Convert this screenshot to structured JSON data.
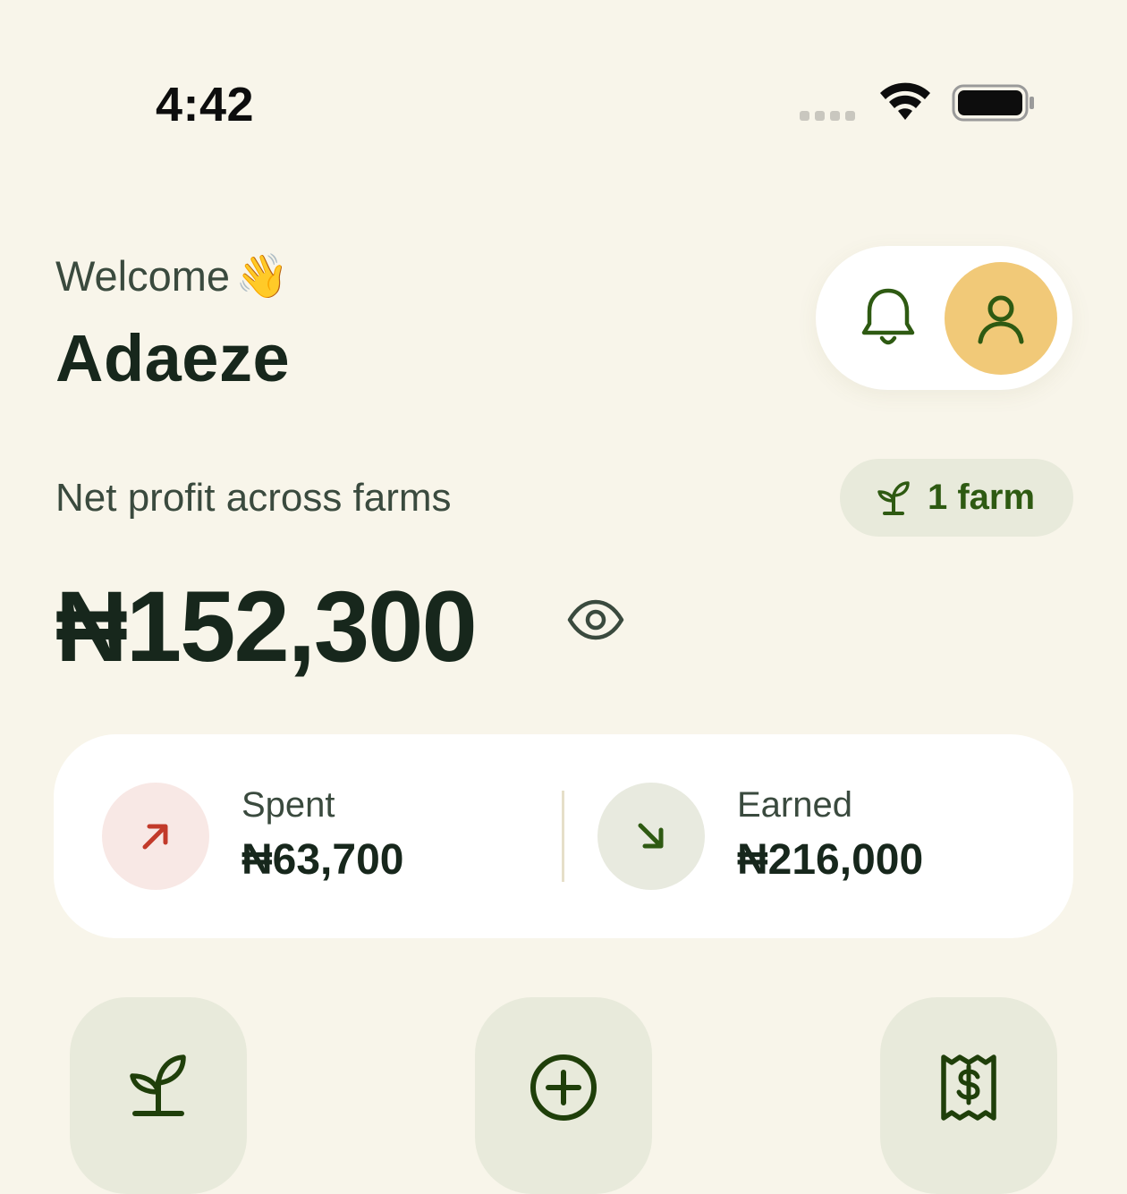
{
  "status_bar": {
    "time": "4:42"
  },
  "header": {
    "greeting": "Welcome",
    "greeting_emoji": "👋",
    "user_name": "Adaeze"
  },
  "summary": {
    "net_label": "Net profit across farms",
    "farm_count_label": "1 farm",
    "net_amount": "₦152,300",
    "spent_label": "Spent",
    "spent_amount": "₦63,700",
    "earned_label": "Earned",
    "earned_amount": "₦216,000"
  },
  "actions": [
    {
      "icon": "sprout-icon"
    },
    {
      "icon": "add-circle-icon"
    },
    {
      "icon": "receipt-dollar-icon"
    }
  ],
  "colors": {
    "background": "#F8F5EA",
    "primary_green": "#2E5A12",
    "avatar_bg": "#F1C978",
    "spent_red": "#C23A2A",
    "tile_bg": "#E8EADB"
  }
}
